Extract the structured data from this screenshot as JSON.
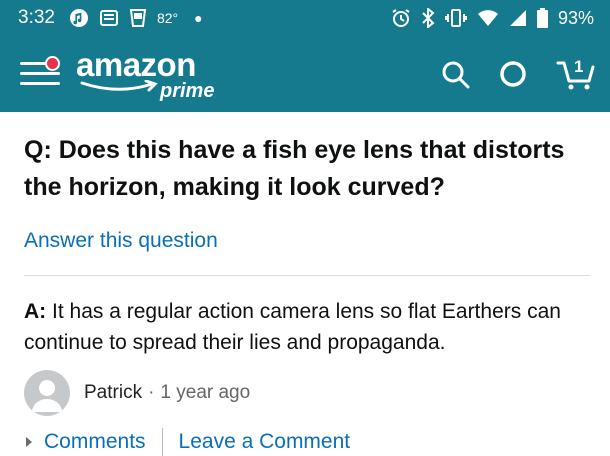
{
  "status_bar": {
    "time": "3:32",
    "temperature": "82°",
    "battery_percent": "93%"
  },
  "nav": {
    "logo_word": "amazon",
    "logo_sub": "prime",
    "cart_count": "1",
    "brand_color": "#157a8e"
  },
  "qa": {
    "question": "Q: Does this have a fish eye lens that distorts the horizon, making it look curved?",
    "answer_link": "Answer this question",
    "answer_prefix": "A:",
    "answer_text": "It has a regular action camera lens so flat Earthers can continue to spread their lies and propaganda.",
    "author": "Patrick",
    "separator": "·",
    "time_ago": "1 year ago",
    "comments_label": "Comments",
    "leave_comment_label": "Leave a Comment",
    "link_color": "#0a6fb8"
  },
  "icons": [
    "music-note-icon",
    "news-icon",
    "cup-icon",
    "alarm-icon",
    "bluetooth-icon",
    "vibrate-icon",
    "wifi-icon",
    "signal-icon",
    "battery-icon",
    "menu-icon",
    "search-icon",
    "alexa-icon",
    "cart-icon",
    "avatar-icon",
    "caret-right-icon"
  ]
}
